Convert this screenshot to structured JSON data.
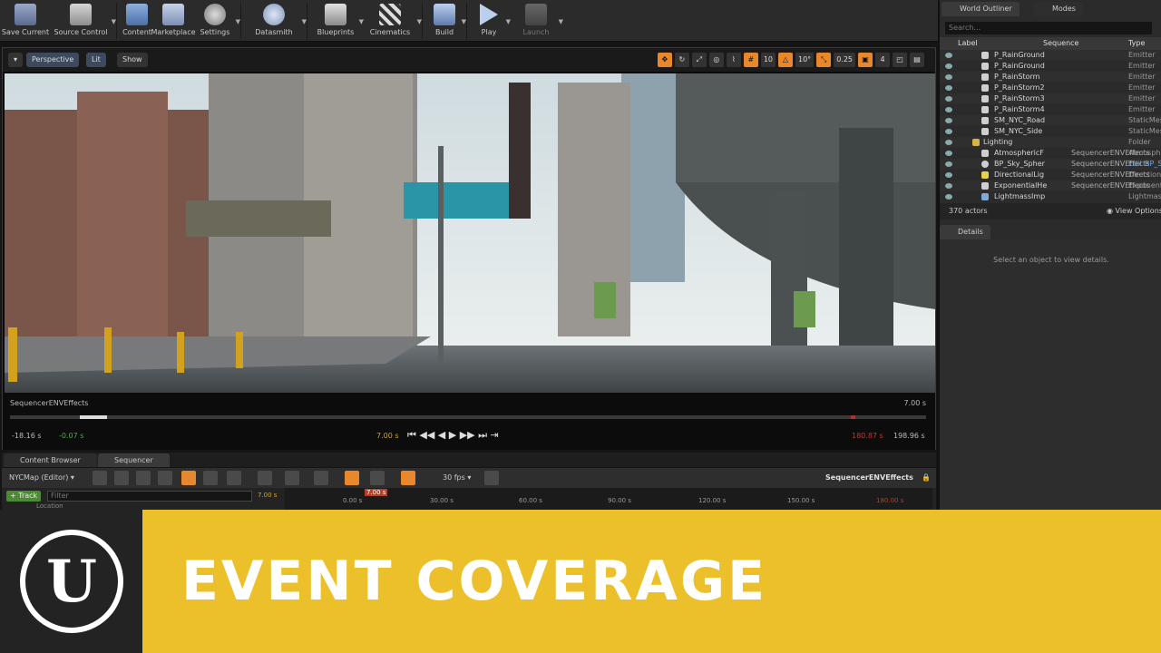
{
  "toolbar": {
    "buttons": [
      {
        "label": "Save Current"
      },
      {
        "label": "Source Control"
      },
      {
        "label": "Content"
      },
      {
        "label": "Marketplace"
      },
      {
        "label": "Settings"
      },
      {
        "label": "Datasmith"
      },
      {
        "label": "Blueprints"
      },
      {
        "label": "Cinematics"
      },
      {
        "label": "Build"
      },
      {
        "label": "Play"
      },
      {
        "label": "Launch"
      }
    ]
  },
  "viewport": {
    "perspective_label": "Perspective",
    "lit_label": "Lit",
    "show_label": "Show",
    "grid_value": "10",
    "angle_value": "10°",
    "scale_value": "0.25",
    "camera_speed": "4",
    "sequence_name": "SequencerENVEffects",
    "current_time": "7.00 s",
    "time_start": "-18.16 s",
    "time_offset": "-0.07 s",
    "time_current": "7.00 s",
    "time_end_red": "180.87 s",
    "time_total": "198.96 s"
  },
  "bottom": {
    "tab_content_browser": "Content Browser",
    "tab_sequencer": "Sequencer",
    "map_label": "NYCMap (Editor)",
    "fps_label": "30 fps",
    "sequence_title": "SequencerENVEffects",
    "add_track": "+ Track",
    "filter_placeholder": "Filter",
    "time_left": "7.00 s",
    "playhead_time": "7.00 s",
    "ruler_ticks": [
      "0.00 s",
      "30.00 s",
      "60.00 s",
      "90.00 s",
      "120.00 s",
      "150.00 s",
      "180.00 s"
    ],
    "location_label": "Location"
  },
  "outliner": {
    "tab_world": "World Outliner",
    "tab_modes": "Modes",
    "search_placeholder": "Search...",
    "col_label": "Label",
    "col_sequence": "Sequence",
    "col_type": "Type",
    "rows": [
      {
        "label": "P_RainGround",
        "sequence": "",
        "type": "Emitter"
      },
      {
        "label": "P_RainGround",
        "sequence": "",
        "type": "Emitter"
      },
      {
        "label": "P_RainStorm",
        "sequence": "",
        "type": "Emitter"
      },
      {
        "label": "P_RainStorm2",
        "sequence": "",
        "type": "Emitter"
      },
      {
        "label": "P_RainStorm3",
        "sequence": "",
        "type": "Emitter"
      },
      {
        "label": "P_RainStorm4",
        "sequence": "",
        "type": "Emitter"
      },
      {
        "label": "SM_NYC_Road",
        "sequence": "",
        "type": "StaticMesh"
      },
      {
        "label": "SM_NYC_Side",
        "sequence": "",
        "type": "StaticMesh"
      },
      {
        "label": "Lighting",
        "sequence": "",
        "type": "Folder"
      },
      {
        "label": "AtmosphericF",
        "sequence": "SequencerENVEffects",
        "type": "Atmosphe"
      },
      {
        "label": "BP_Sky_Spher",
        "sequence": "SequencerENVEffects",
        "type": "Edit BP_S"
      },
      {
        "label": "DirectionalLig",
        "sequence": "SequencerENVEffects",
        "type": "Directiona"
      },
      {
        "label": "ExponentialHe",
        "sequence": "SequencerENVEffects",
        "type": "Exponentia"
      },
      {
        "label": "LightmassImp",
        "sequence": "",
        "type": "Lightmass"
      }
    ],
    "actor_count": "370 actors",
    "view_options": "View Options"
  },
  "details": {
    "tab_label": "Details",
    "empty_message": "Select an object to view details."
  },
  "banner": {
    "title": "EVENT COVERAGE"
  },
  "colors": {
    "banner_yellow": "#ecc02a",
    "accent_orange": "#e8872b",
    "panel_dark": "#2b2b2b"
  }
}
